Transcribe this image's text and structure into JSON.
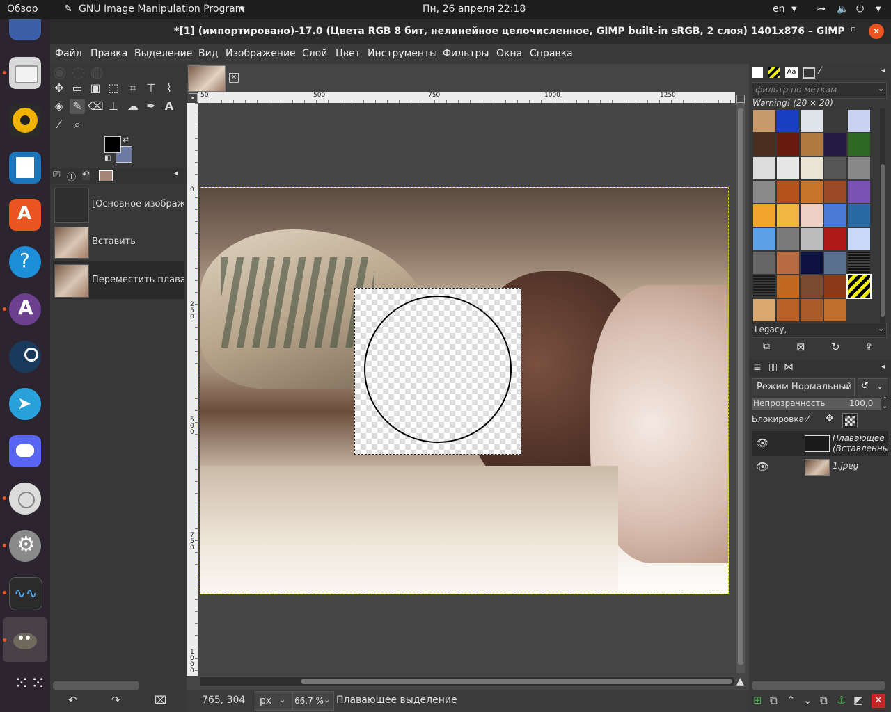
{
  "top_panel": {
    "activities": "Обзор",
    "app_name": "GNU Image Manipulation Program",
    "clock": "Пн, 26 апреля  22:18",
    "language": "en"
  },
  "window": {
    "title": "*[1] (импортировано)-17.0 (Цвета RGB 8 бит, нелинейное целочисленное, GIMP built-in sRGB, 2 слоя) 1401x876 – GIMP"
  },
  "menu": [
    "Файл",
    "Правка",
    "Выделение",
    "Вид",
    "Изображение",
    "Слой",
    "Цвет",
    "Инструменты",
    "Фильтры",
    "Окна",
    "Справка"
  ],
  "undo_history": [
    {
      "label": "[Основное изображение]"
    },
    {
      "label": "Вставить"
    },
    {
      "label": "Переместить плавающ"
    }
  ],
  "rulers": {
    "top": [
      "50",
      "500",
      "750",
      "1000",
      "1250"
    ],
    "left": [
      "0",
      "250",
      "500",
      "750",
      "1000"
    ]
  },
  "status": {
    "coords": "765, 304",
    "unit": "px",
    "zoom": "66,7 %",
    "message": "Плавающее выделение"
  },
  "patterns": {
    "filter_placeholder": "фильтр по меткам",
    "selected_name": "Warning! (20 × 20)",
    "tag": "Legacy,"
  },
  "layers": {
    "mode_label": "Режим Нормальный",
    "opacity_label": "Непрозрачность",
    "opacity_value": "100,0",
    "lock_label": "Блокировка:",
    "items": [
      {
        "name_line1": "Плавающее в",
        "name_line2": "(Вставленны"
      },
      {
        "name_line1": "1.jpeg",
        "name_line2": ""
      }
    ]
  },
  "colors": {
    "accent": "#e95420",
    "panel": "#383838",
    "canvas": "#454545"
  }
}
